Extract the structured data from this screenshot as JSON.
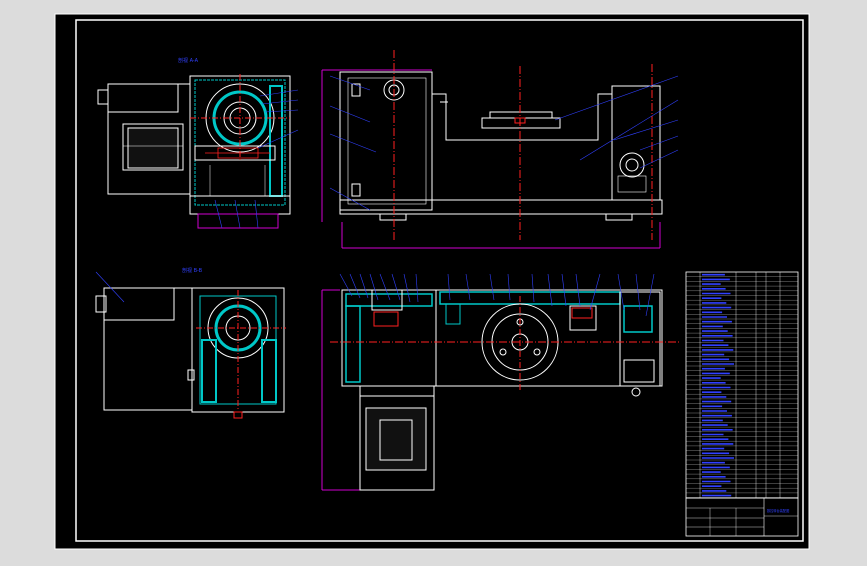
{
  "viewport": {
    "background": "#dcdcdc",
    "paper": "#000000"
  },
  "colors": {
    "line": "#ffffff",
    "hatch": "#00c8c8",
    "dim": "#d000d0",
    "center": "#ff2020",
    "red": "#ff2020",
    "leader": "#3040ff",
    "text": "#3040ff",
    "fill_dark": "#0a0a0a"
  },
  "views": {
    "section_a": {
      "title": "剖视 A-A"
    },
    "section_b": {
      "title": "剖视 B-B"
    }
  },
  "title_block": {
    "title": "数控转台装配图"
  }
}
